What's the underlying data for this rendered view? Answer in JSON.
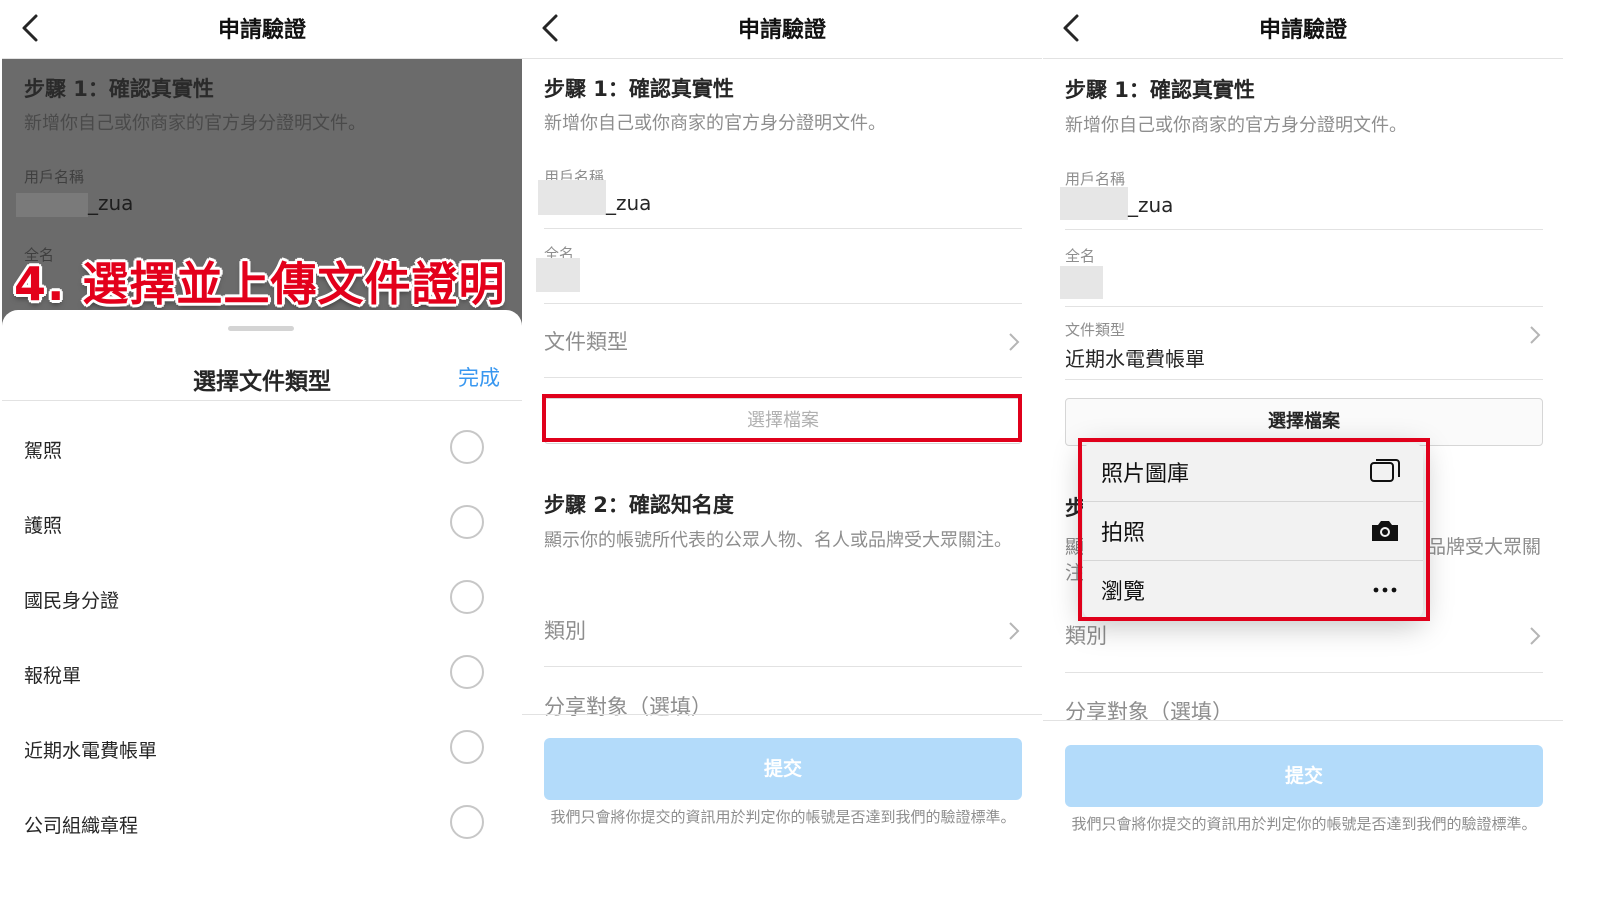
{
  "common": {
    "page_title": "申請驗證",
    "step1_title": "步驟 1：確認真實性",
    "step1_desc": "新增你自己或你商家的官方身分證明文件。",
    "username_label": "用戶名稱",
    "username_value": "_zua",
    "fullname_label": "全名",
    "doc_type_label": "文件類型",
    "choose_file": "選擇檔案",
    "step2_title": "步驟 2：確認知名度",
    "step2_desc": "顯示你的帳號所代表的公眾人物、名人或品牌受大眾關注。",
    "category_label": "類別",
    "audience_label": "分享對象（選填）",
    "submit_label": "提交",
    "footer_note": "我們只會將你提交的資訊用於判定你的帳號是否達到我們的驗證標準。"
  },
  "panel1": {
    "caption": "4. 選擇並上傳文件證明",
    "sheet_title": "選擇文件類型",
    "done_label": "完成",
    "options": [
      "駕照",
      "護照",
      "國民身分證",
      "報稅單",
      "近期水電費帳單",
      "公司組織章程"
    ]
  },
  "panel3": {
    "selected_doc_type": "近期水電費帳單",
    "menu": [
      {
        "label": "照片圖庫",
        "icon": "photo-library-icon"
      },
      {
        "label": "拍照",
        "icon": "camera-icon"
      },
      {
        "label": "瀏覽",
        "icon": "more-icon"
      }
    ],
    "peek_step": "步",
    "peek_desc_right": "品牌受大眾關",
    "peek_desc_left1": "顯",
    "peek_desc_left2": "注"
  },
  "colors": {
    "accent": "#3897f0",
    "submit_disabled": "#b3dbfa",
    "highlight": "#e0001b"
  }
}
